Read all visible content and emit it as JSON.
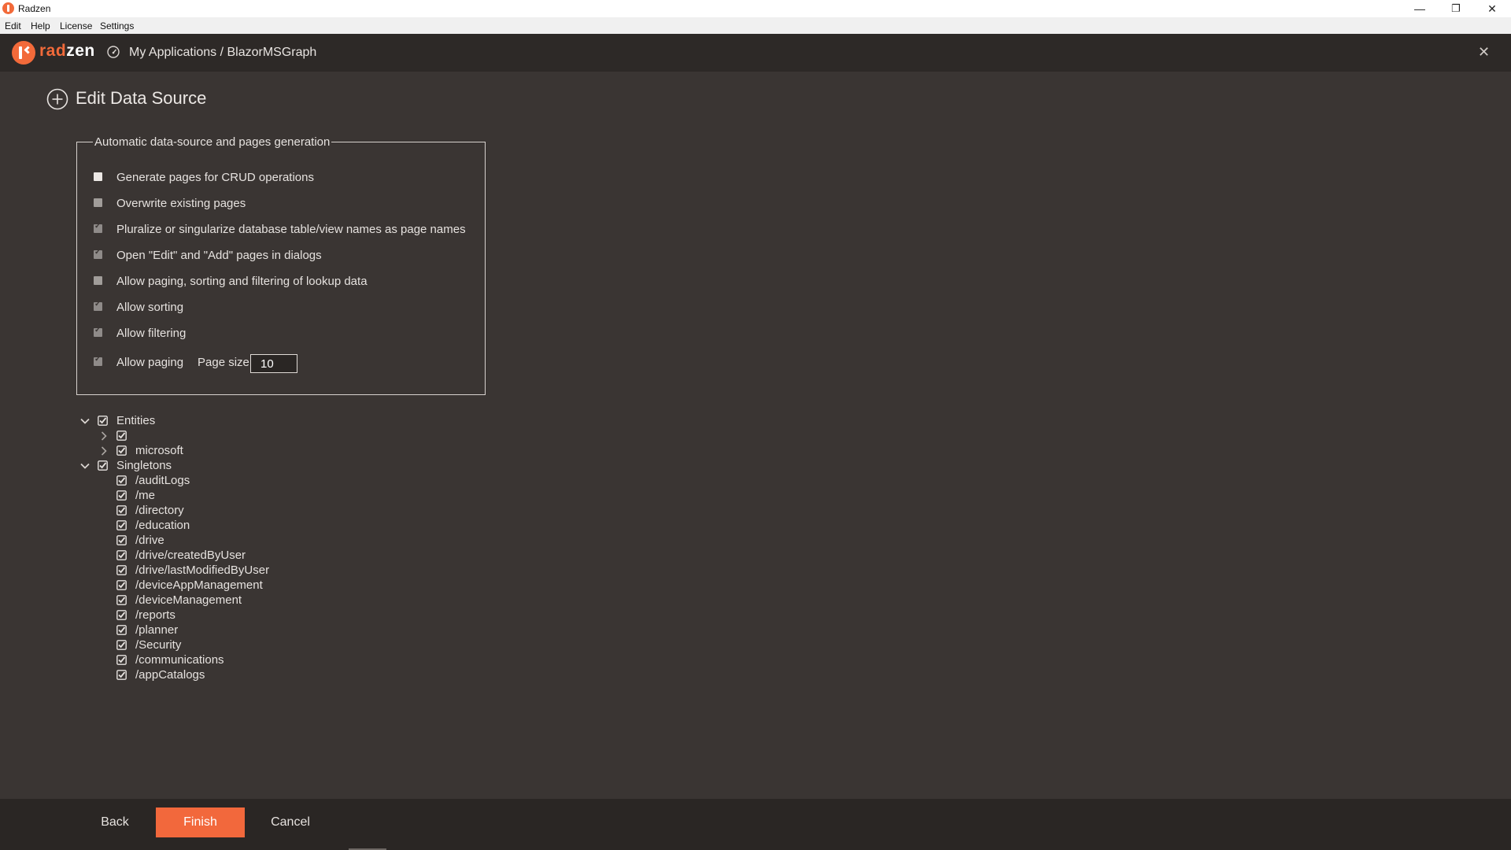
{
  "window": {
    "title": "Radzen",
    "minimize": "—",
    "restore": "❐",
    "close": "✕"
  },
  "menu": [
    "Edit",
    "Help",
    "License",
    "Settings"
  ],
  "header": {
    "logo_text_a": "rad",
    "logo_text_b": "zen",
    "breadcrumb": "My Applications / BlazorMSGraph",
    "close": "✕",
    "icons": {
      "logo": "radzen-logo-icon",
      "dashboard": "dashboard-icon"
    }
  },
  "page": {
    "title": "Edit Data Source",
    "title_icon": "plus-circle-icon"
  },
  "generation": {
    "legend": "Automatic data-source and pages generation",
    "options": [
      {
        "label": "Generate pages for CRUD operations",
        "checked": false
      },
      {
        "label": "Overwrite existing pages",
        "checked": false
      },
      {
        "label": "Pluralize or singularize database table/view names as page names",
        "checked": true
      },
      {
        "label": "Open \"Edit\" and \"Add\" pages in dialogs",
        "checked": true
      },
      {
        "label": "Allow paging, sorting and filtering of lookup data",
        "checked": false
      },
      {
        "label": "Allow sorting",
        "checked": true
      },
      {
        "label": "Allow filtering",
        "checked": true
      },
      {
        "label": "Allow paging",
        "checked": true
      }
    ],
    "page_size_label": "Page size",
    "page_size": "10"
  },
  "tree": {
    "entities": {
      "label": "Entities",
      "expanded": true,
      "children": [
        {
          "label": "",
          "expanded": false
        },
        {
          "label": "microsoft",
          "expanded": false
        }
      ]
    },
    "singletons": {
      "label": "Singletons",
      "expanded": true,
      "children": [
        "/auditLogs",
        "/me",
        "/directory",
        "/education",
        "/drive",
        "/drive/createdByUser",
        "/drive/lastModifiedByUser",
        "/deviceAppManagement",
        "/deviceManagement",
        "/reports",
        "/planner",
        "/Security",
        "/communications",
        "/appCatalogs"
      ]
    }
  },
  "footer": {
    "back": "Back",
    "finish": "Finish",
    "cancel": "Cancel",
    "finish_color": "#f2683c"
  },
  "colors": {
    "background": "#3a3533",
    "appbar": "#2d2927",
    "accent": "#f26a3a"
  }
}
